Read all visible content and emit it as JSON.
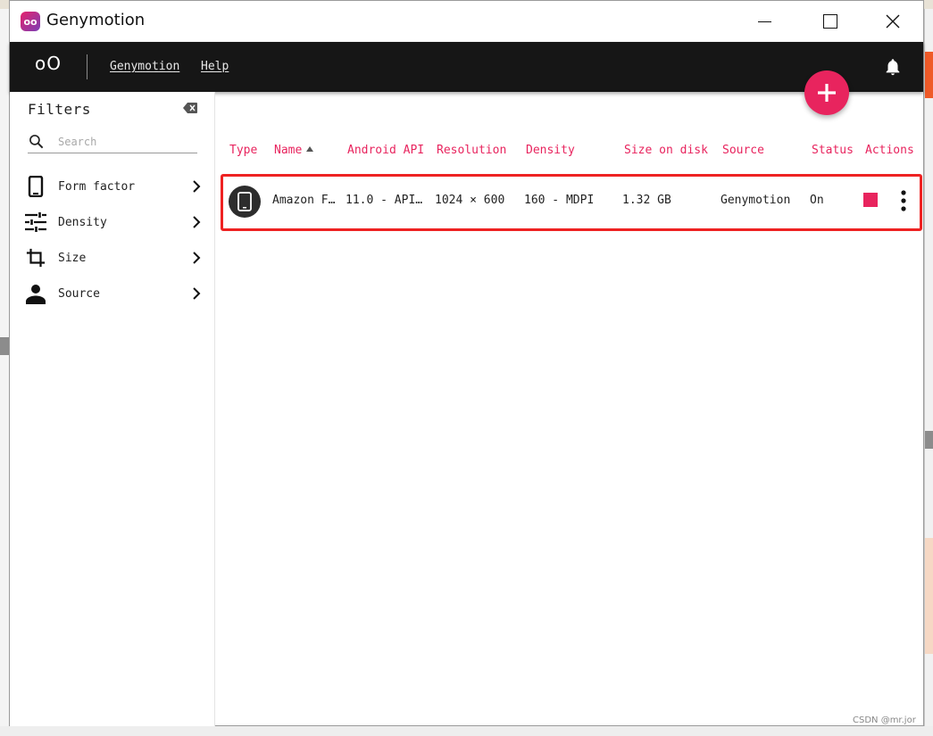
{
  "window": {
    "title": "Genymotion",
    "logo_text": "oo"
  },
  "appbar": {
    "logo": "oO",
    "menu": [
      {
        "label": "Genymotion"
      },
      {
        "label": "Help"
      }
    ],
    "icons": {
      "notifications": "bell-icon",
      "add": "plus-icon"
    }
  },
  "sidebar": {
    "title": "Filters",
    "search_placeholder": "Search",
    "items": [
      {
        "label": "Form factor",
        "icon": "phone-icon"
      },
      {
        "label": "Density",
        "icon": "tune-icon"
      },
      {
        "label": "Size",
        "icon": "crop-icon"
      },
      {
        "label": "Source",
        "icon": "person-icon"
      }
    ]
  },
  "table": {
    "columns": [
      "Type",
      "Name",
      "Android API",
      "Resolution",
      "Density",
      "Size on disk",
      "Source",
      "Status",
      "Actions"
    ],
    "sorted_column": "Name",
    "sort_direction": "ascending",
    "rows": [
      {
        "type_icon": "tablet-icon",
        "name": "Amazon F…",
        "android_api": "11.0 - API…",
        "resolution": "1024 × 600",
        "density": "160 - MDPI",
        "size_on_disk": "1.32 GB",
        "source": "Genymotion",
        "status": "On"
      }
    ]
  },
  "colors": {
    "accent": "#e8245e",
    "appbar": "#161616",
    "highlight": "#ee2222"
  },
  "watermark": "CSDN @mr.jor"
}
